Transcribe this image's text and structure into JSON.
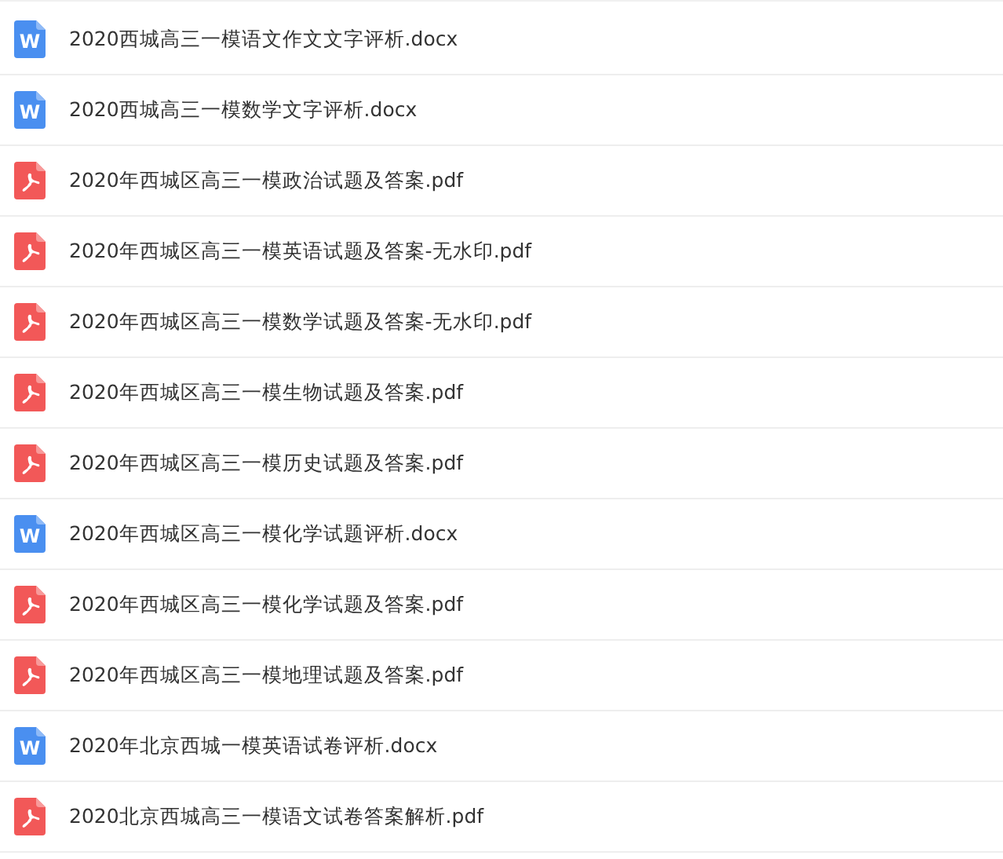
{
  "files": [
    {
      "kind": "docx",
      "icon_letter": "W",
      "name": "2020西城高三一模语文作文文字评析.docx"
    },
    {
      "kind": "docx",
      "icon_letter": "W",
      "name": "2020西城高三一模数学文字评析.docx"
    },
    {
      "kind": "pdf",
      "name": "2020年西城区高三一模政治试题及答案.pdf"
    },
    {
      "kind": "pdf",
      "name": "2020年西城区高三一模英语试题及答案-无水印.pdf"
    },
    {
      "kind": "pdf",
      "name": "2020年西城区高三一模数学试题及答案-无水印.pdf"
    },
    {
      "kind": "pdf",
      "name": "2020年西城区高三一模生物试题及答案.pdf"
    },
    {
      "kind": "pdf",
      "name": "2020年西城区高三一模历史试题及答案.pdf"
    },
    {
      "kind": "docx",
      "icon_letter": "W",
      "name": "2020年西城区高三一模化学试题评析.docx"
    },
    {
      "kind": "pdf",
      "name": "2020年西城区高三一模化学试题及答案.pdf"
    },
    {
      "kind": "pdf",
      "name": "2020年西城区高三一模地理试题及答案.pdf"
    },
    {
      "kind": "docx",
      "icon_letter": "W",
      "name": "2020年北京西城一模英语试卷评析.docx"
    },
    {
      "kind": "pdf",
      "name": "2020北京西城高三一模语文试卷答案解析.pdf"
    }
  ]
}
